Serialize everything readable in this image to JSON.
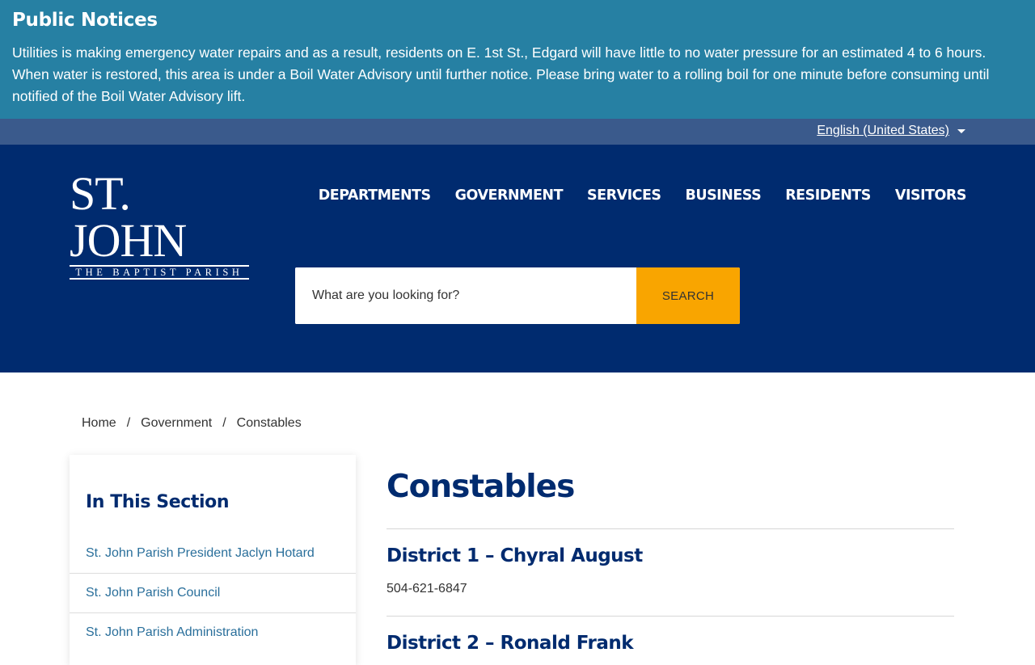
{
  "notice": {
    "title": "Public Notices",
    "text": "Utilities is making emergency water repairs and as a result, residents on E. 1st St., Edgard will have little to no water pressure for an estimated 4 to 6 hours. When water is restored, this area is under a Boil Water Advisory until further notice. Please bring water to a rolling boil for one minute before consuming until notified of the Boil Water Advisory lift."
  },
  "language": {
    "selected": "English (United States)",
    "icon": "caret-down-icon"
  },
  "logo": {
    "line1": "ST. JOHN",
    "line2": "THE BAPTIST PARISH"
  },
  "nav": {
    "items": [
      "DEPARTMENTS",
      "GOVERNMENT",
      "SERVICES",
      "BUSINESS",
      "RESIDENTS",
      "VISITORS"
    ]
  },
  "search": {
    "placeholder": "What are you looking for?",
    "button": "SEARCH"
  },
  "breadcrumb": {
    "home": "Home",
    "separator": "/",
    "section": "Government",
    "current": "Constables"
  },
  "sidebar": {
    "title": "In This Section",
    "items": [
      "St. John Parish President Jaclyn Hotard",
      "St. John Parish Council",
      "St. John Parish Administration"
    ]
  },
  "main": {
    "title": "Constables",
    "districts": [
      {
        "name": "District 1 – Chyral August",
        "phone": "504-621-6847"
      },
      {
        "name": "District 2 – Ronald Frank",
        "phone": ""
      }
    ]
  },
  "colors": {
    "notice_bg": "#2680a3",
    "lang_bar_bg": "#3a5a8c",
    "header_bg": "#002b6f",
    "search_button": "#f9a500",
    "heading": "#002b6f",
    "link": "#2a6f9b"
  }
}
